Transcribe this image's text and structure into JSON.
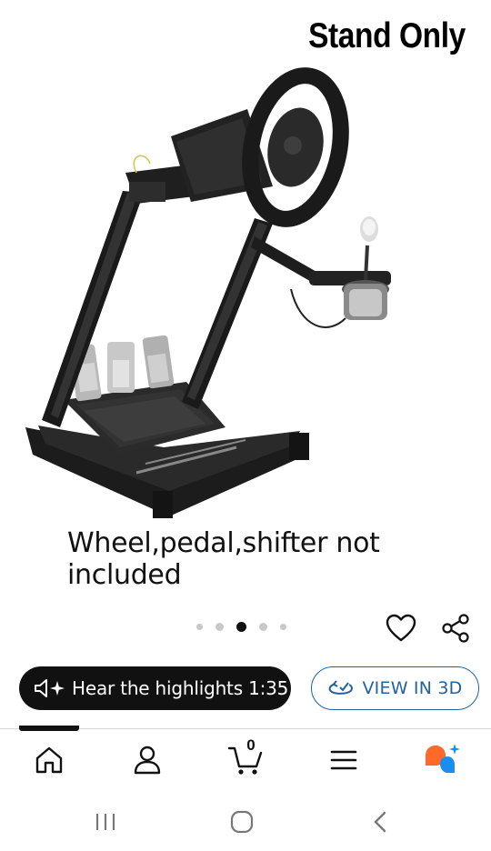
{
  "product": {
    "overlay_title": "Stand Only",
    "overlay_caption": "Wheel,pedal,shifter not included",
    "image_alt": "racing wheel stand with steering wheel, shifter and pedals"
  },
  "carousel": {
    "dot_count": 5,
    "active_index": 2
  },
  "actions": {
    "hear_label": "Hear the highlights 1:35",
    "view3d_label": "VIEW IN 3D"
  },
  "tabbar": {
    "active_tab": "home",
    "tabs": [
      "home",
      "account",
      "cart",
      "menu",
      "rufus"
    ],
    "cart_count": "0"
  },
  "colors": {
    "link_blue": "#2162a1",
    "rufus_orange": "#ff6a2a",
    "rufus_blue": "#1a8ef0",
    "text_dark": "#111111"
  },
  "icons": {
    "heart": "heart-outline-icon",
    "share": "share-icon",
    "speaker": "speaker-sparkle-icon",
    "rotate3d": "rotate-3d-icon",
    "home": "home-icon",
    "account": "person-icon",
    "cart": "cart-icon",
    "menu": "hamburger-icon",
    "rufus": "rufus-assistant-icon",
    "recent": "recent-apps-icon",
    "home_sys": "system-home-icon",
    "back": "back-icon"
  }
}
